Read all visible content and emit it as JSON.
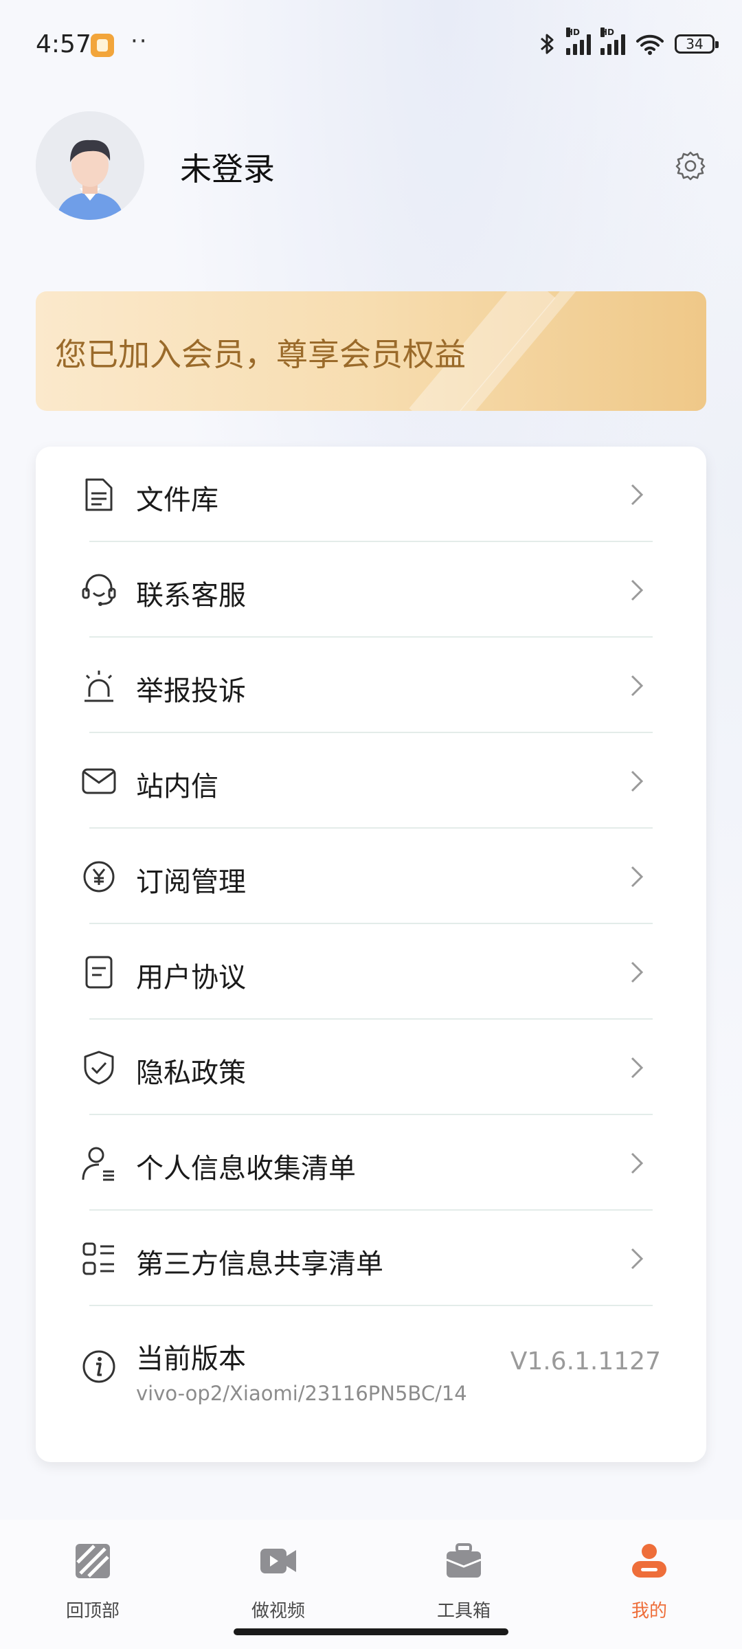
{
  "status_bar": {
    "time": "4:57",
    "dots": "··",
    "hd1": "HD",
    "hd2": "HD",
    "battery": "34"
  },
  "profile": {
    "username": "未登录"
  },
  "member_banner": {
    "text": "您已加入会员，尊享会员权益"
  },
  "menu": {
    "items": [
      {
        "label": "文件库",
        "icon": "document-icon"
      },
      {
        "label": "联系客服",
        "icon": "headset-icon"
      },
      {
        "label": "举报投诉",
        "icon": "alarm-icon"
      },
      {
        "label": "站内信",
        "icon": "mail-icon"
      },
      {
        "label": "订阅管理",
        "icon": "yen-icon"
      },
      {
        "label": "用户协议",
        "icon": "agreement-icon"
      },
      {
        "label": "隐私政策",
        "icon": "shield-check-icon"
      },
      {
        "label": "个人信息收集清单",
        "icon": "user-list-icon"
      },
      {
        "label": "第三方信息共享清单",
        "icon": "grid-list-icon"
      }
    ],
    "version": {
      "label": "当前版本",
      "subtitle": "vivo-op2/Xiaomi/23116PN5BC/14",
      "value": "V1.6.1.1127",
      "icon": "info-icon"
    }
  },
  "bottom_nav": {
    "items": [
      {
        "label": "回顶部",
        "icon": "top-icon"
      },
      {
        "label": "做视频",
        "icon": "video-icon"
      },
      {
        "label": "工具箱",
        "icon": "toolbox-icon"
      },
      {
        "label": "我的",
        "icon": "profile-icon",
        "active": true
      }
    ],
    "active_color": "#ee6e3a"
  }
}
